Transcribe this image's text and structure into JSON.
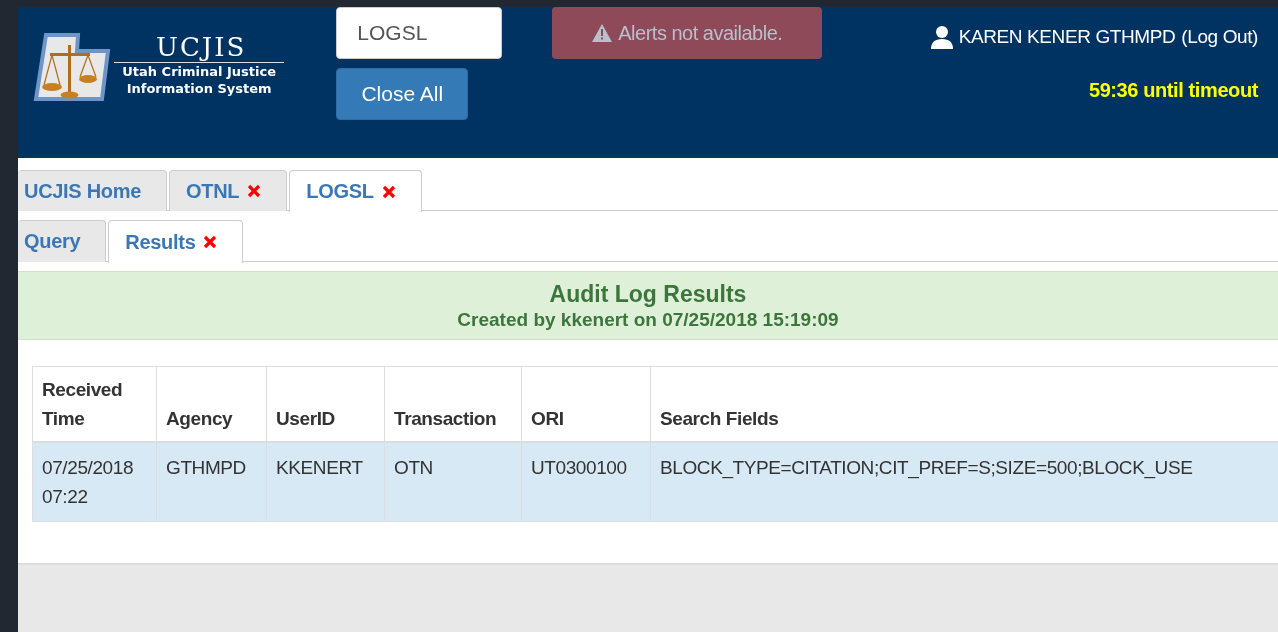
{
  "logo": {
    "title": "UCJIS",
    "subtitle_lines": [
      "Utah Criminal Justice",
      "Information System"
    ]
  },
  "command_field": {
    "value": "LOGSL"
  },
  "close_all_button": "Close All",
  "alert": {
    "text": "Alerts not available.",
    "disabled": true
  },
  "user": {
    "name": "KAREN KENER GTHMPD",
    "logout": "(Log Out)"
  },
  "timeout": "59:36 until timeout",
  "tabs": [
    {
      "label": "UCJIS Home",
      "selected": false,
      "closable": false
    },
    {
      "label": "OTNL",
      "selected": false,
      "closable": true
    },
    {
      "label": "LOGSL",
      "selected": true,
      "closable": true
    }
  ],
  "subtabs": [
    {
      "label": "Query",
      "selected": false,
      "closable": false
    },
    {
      "label": "Results",
      "selected": true,
      "closable": true
    }
  ],
  "banner": {
    "title": "Audit Log Results",
    "subtitle": "Created by kkenert on 07/25/2018 15:19:09"
  },
  "table": {
    "columns": [
      "Received Time",
      "Agency",
      "UserID",
      "Transaction",
      "ORI",
      "Search Fields"
    ],
    "rows": [
      {
        "selected": true,
        "cells": [
          "07/25/2018 07:22",
          "GTHMPD",
          "KKENERT",
          "OTN",
          "UT0300100",
          "BLOCK_TYPE=CITATION;CIT_PREF=S;SIZE=500;BLOCK_USE"
        ]
      }
    ]
  }
}
